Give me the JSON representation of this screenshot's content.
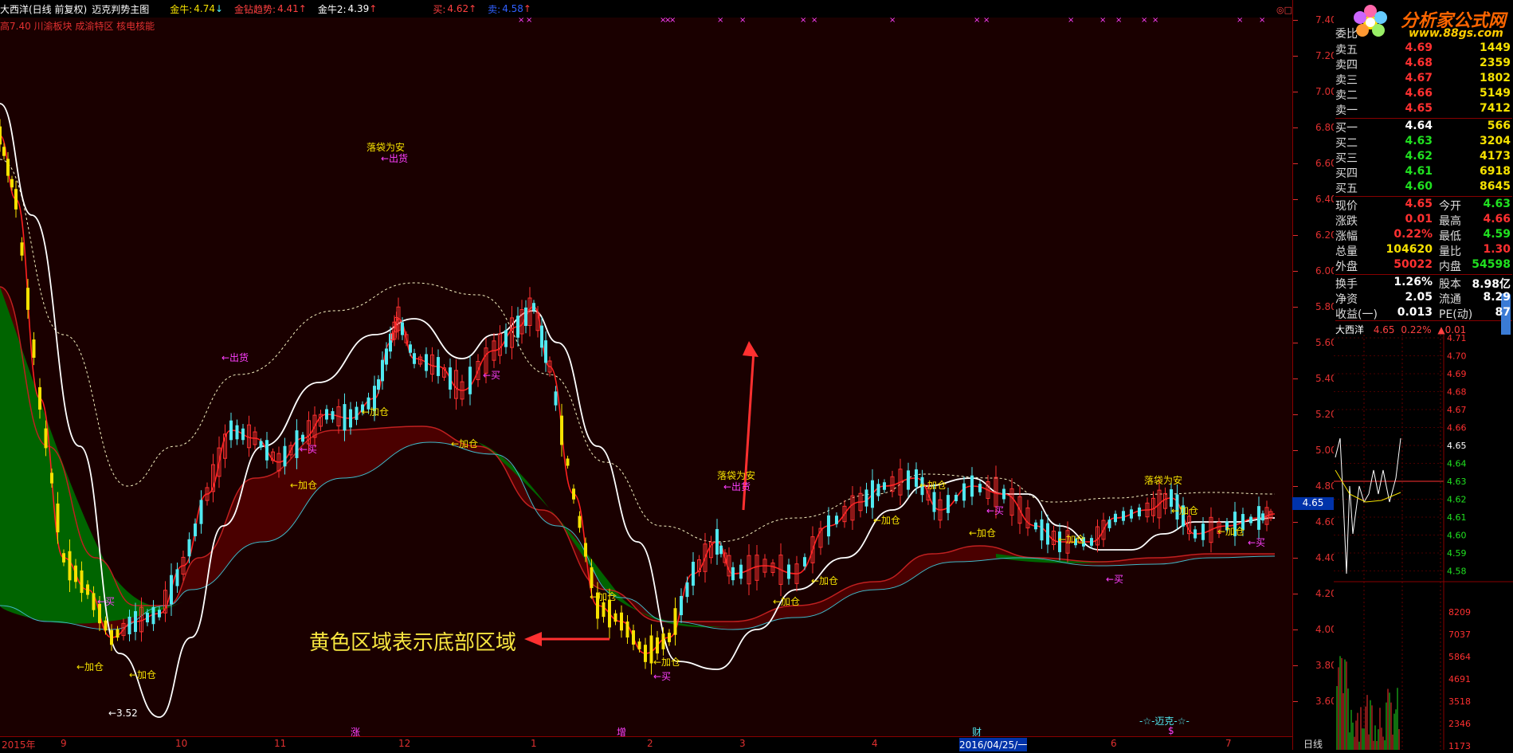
{
  "toolbar": {
    "stock_name": "大西洋(日线 前复权)",
    "indicator": "迈克判势主图",
    "gold_bull_label": "金牛:",
    "gold_bull_value": "4.74",
    "gold_trend_label": "金钻趋势:",
    "gold_trend_value": "4.41",
    "gold_bull2_label": "金牛2:",
    "gold_bull2_value": "4.39",
    "buy_label": "买:",
    "buy_value": "4.62",
    "sell_label": "卖:",
    "sell_value": "4.58"
  },
  "subtitle": "高7.40 川渝板块 成渝特区 核电核能",
  "annotations": {
    "safe": "落袋为安",
    "sell": "←出货",
    "add": "←加仓",
    "buy": "←买",
    "low_label": "←3.52",
    "note": "黄色区域表示底部区域",
    "mike": "-☆-迈克-☆-"
  },
  "price_axis": [
    "7.40",
    "7.20",
    "7.00",
    "6.80",
    "6.60",
    "6.40",
    "6.20",
    "6.00",
    "5.80",
    "5.60",
    "5.40",
    "5.20",
    "5.00",
    "4.80",
    "4.60",
    "4.40",
    "4.20",
    "4.00",
    "3.80",
    "3.60"
  ],
  "current_price_tag": "4.65",
  "date_axis": [
    {
      "label": "2015年"
    },
    {
      "label": "9"
    },
    {
      "label": "10"
    },
    {
      "label": "11"
    },
    {
      "label": "12"
    },
    {
      "label": "1"
    },
    {
      "label": "2"
    },
    {
      "label": "3"
    },
    {
      "label": "4"
    },
    {
      "label": "2016/04/25/一"
    },
    {
      "label": "6"
    },
    {
      "label": "7"
    }
  ],
  "event_marks": [
    "涨",
    "增",
    "财",
    "$"
  ],
  "period": "日线",
  "logo": {
    "text": "分析家公式网",
    "url": "www.88gs.com"
  },
  "orderbook": {
    "title": "委比",
    "asks": [
      {
        "label": "卖五",
        "price": "4.69",
        "vol": "1449"
      },
      {
        "label": "卖四",
        "price": "4.68",
        "vol": "2359"
      },
      {
        "label": "卖三",
        "price": "4.67",
        "vol": "1802"
      },
      {
        "label": "卖二",
        "price": "4.66",
        "vol": "5149"
      },
      {
        "label": "卖一",
        "price": "4.65",
        "vol": "7412"
      }
    ],
    "bids": [
      {
        "label": "买一",
        "price": "4.64",
        "vol": "566"
      },
      {
        "label": "买二",
        "price": "4.63",
        "vol": "3204"
      },
      {
        "label": "买三",
        "price": "4.62",
        "vol": "4173"
      },
      {
        "label": "买四",
        "price": "4.61",
        "vol": "6918"
      },
      {
        "label": "买五",
        "price": "4.60",
        "vol": "8645"
      }
    ]
  },
  "quote": [
    {
      "l1": "现价",
      "v1": "4.65",
      "l2": "今开",
      "v2": "4.63",
      "c1": "up",
      "c2": "dn"
    },
    {
      "l1": "涨跌",
      "v1": "0.01",
      "l2": "最高",
      "v2": "4.66",
      "c1": "up",
      "c2": "up"
    },
    {
      "l1": "涨幅",
      "v1": "0.22%",
      "l2": "最低",
      "v2": "4.59",
      "c1": "up",
      "c2": "dn"
    },
    {
      "l1": "总量",
      "v1": "104620",
      "l2": "量比",
      "v2": "1.30",
      "c1": "yl",
      "c2": "up"
    },
    {
      "l1": "外盘",
      "v1": "50022",
      "l2": "内盘",
      "v2": "54598",
      "c1": "up",
      "c2": "dn"
    }
  ],
  "fundamentals": [
    {
      "l1": "换手",
      "v1": "1.26%",
      "l2": "股本",
      "v2": "8.98亿"
    },
    {
      "l1": "净资",
      "v1": "2.05",
      "l2": "流通",
      "v2": "8.29"
    },
    {
      "l1": "收益(一)",
      "v1": "0.013",
      "l2": "PE(动)",
      "v2": "87"
    }
  ],
  "mini": {
    "name": "大西洋",
    "price": "4.65",
    "pct": "0.22%",
    "chg": "▲0.01",
    "price_axis": [
      "4.71",
      "4.70",
      "4.69",
      "4.68",
      "4.67",
      "4.66",
      "4.65",
      "4.64",
      "4.63",
      "4.62",
      "4.61",
      "4.60",
      "4.59",
      "4.58"
    ],
    "vol_axis": [
      "8209",
      "7037",
      "5864",
      "4691",
      "3518",
      "2346",
      "1173"
    ]
  },
  "colors": {
    "up": "#ff3030",
    "down": "#50e8f0",
    "bg": "#1a0000",
    "green_band": "#006400",
    "dark_band": "#4a0000"
  }
}
